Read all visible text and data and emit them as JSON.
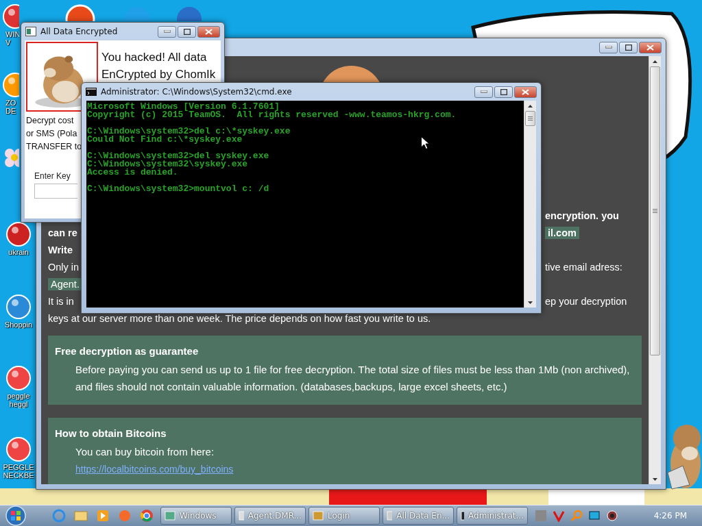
{
  "desktop_icons": [
    {
      "kind": "app",
      "lines": [
        "WIN",
        "V"
      ]
    },
    {
      "kind": "app",
      "lines": [
        "ZO",
        "DE"
      ]
    },
    {
      "kind": "flower"
    },
    {
      "kind": "app",
      "lines": [
        "ukrain"
      ]
    },
    {
      "kind": "app",
      "lines": [
        "Shoppin"
      ]
    },
    {
      "kind": "app",
      "lines": [
        "peggle",
        "heggl"
      ]
    },
    {
      "kind": "app",
      "lines": [
        "PEGGLE",
        "NECKBE"
      ]
    }
  ],
  "ransom_window": {
    "lines": [
      {
        "bold": true,
        "right": {
          "text": "encryption. you",
          "highlight": false
        }
      },
      {
        "bold": true,
        "left": {
          "text": "can re",
          "highlight": false
        },
        "right": {
          "text": "il.com",
          "highlight": true
        }
      },
      {
        "bold": true,
        "left": {
          "text": "Write",
          "highlight": false
        }
      },
      {
        "bold": false,
        "left": {
          "text": "Only in",
          "highlight": false
        },
        "right": {
          "text": "tive email adress:",
          "highlight": false
        }
      },
      {
        "bold": false,
        "left": {
          "text": "Agent.",
          "highlight": true
        }
      },
      {
        "bold": false,
        "left": {
          "text": "It is in",
          "highlight": false
        },
        "right": {
          "text": "ep your decryption",
          "highlight": false
        }
      },
      {
        "bold": false,
        "left": {
          "text": "keys at our server more than one week. The price depends on how fast you write to us.",
          "highlight": false
        }
      }
    ],
    "cards": [
      {
        "title": "Free decryption as guarantee",
        "body": "Before paying you can send us up to 1 file for free decryption. The total size of files must be less than 1Mb (non archived), and files should not contain valuable information. (databases,backups, large excel sheets, etc.)"
      },
      {
        "title": "How to obtain Bitcoins",
        "body": "You can buy bitcoin from here:",
        "link": "https://localbitcoins.com/buy_bitcoins"
      }
    ]
  },
  "encrypted_window": {
    "title": "All Data Encrypted",
    "heading_lines": [
      "You hacked! All data",
      "EnCrypted by ChomIk"
    ],
    "body_lines": [
      "Decrypt cost",
      "or SMS (Pola",
      "TRANSFER to"
    ],
    "key_label": "Enter Key"
  },
  "cmd_window": {
    "title": "Administrator: C:\\Windows\\System32\\cmd.exe",
    "blocks": [
      [
        "Microsoft Windows [Version 6.1.7601]",
        "Copyright (c) 2015 TeamOS.  All rights reserved -www.teamos-hkrg.com."
      ],
      [
        "C:\\Windows\\system32>del c:\\*syskey.exe",
        "Could Not Find c:\\*syskey.exe"
      ],
      [
        "C:\\Windows\\system32>del syskey.exe",
        "C:\\Windows\\system32\\syskey.exe",
        "Access is denied."
      ],
      [
        "C:\\Windows\\system32>mountvol c: /d"
      ]
    ]
  },
  "taskbar": {
    "tasks": [
      {
        "label": "Windows"
      },
      {
        "label": "Agent.DMR..."
      },
      {
        "label": "Login"
      },
      {
        "label": "All Data En..."
      },
      {
        "label": "Administrat..."
      }
    ],
    "clock": "4:26 PM"
  }
}
